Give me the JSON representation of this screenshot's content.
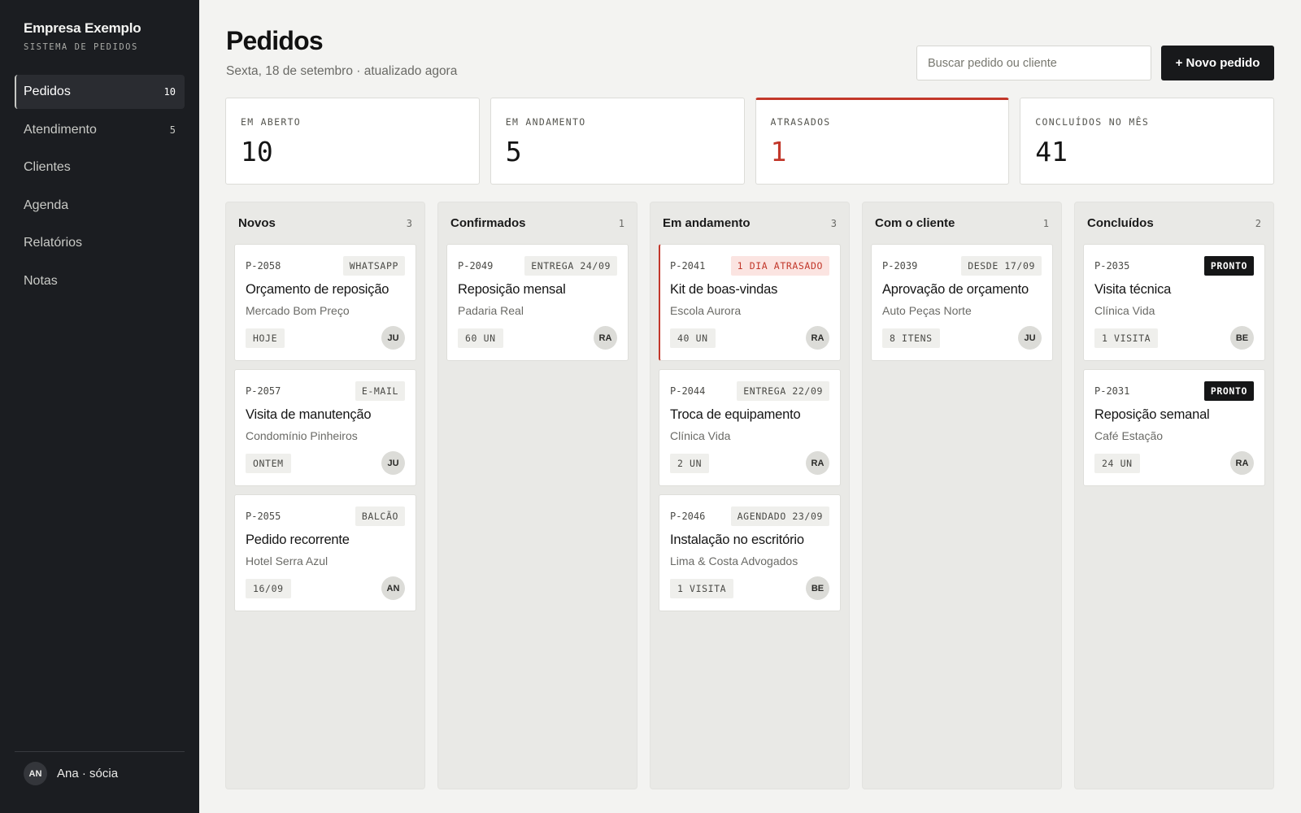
{
  "sidebar": {
    "brand_name": "Empresa Exemplo",
    "brand_sub": "SISTEMA DE PEDIDOS",
    "items": [
      {
        "label": "Pedidos",
        "count": "10",
        "active": true
      },
      {
        "label": "Atendimento",
        "count": "5"
      },
      {
        "label": "Clientes",
        "count": ""
      },
      {
        "label": "Agenda",
        "count": ""
      },
      {
        "label": "Relatórios",
        "count": ""
      },
      {
        "label": "Notas",
        "count": ""
      }
    ],
    "user": {
      "initials": "AN",
      "label": "Ana · sócia"
    }
  },
  "header": {
    "title": "Pedidos",
    "subtitle": "Sexta, 18 de setembro · atualizado agora",
    "search_placeholder": "Buscar pedido ou cliente",
    "new_button": "+ Novo pedido"
  },
  "stats": [
    {
      "label": "EM ABERTO",
      "value": "10"
    },
    {
      "label": "EM ANDAMENTO",
      "value": "5"
    },
    {
      "label": "ATRASADOS",
      "value": "1",
      "alert": true
    },
    {
      "label": "CONCLUÍDOS NO MÊS",
      "value": "41"
    }
  ],
  "board": {
    "columns": [
      {
        "title": "Novos",
        "count": "3",
        "cards": [
          {
            "id": "P-2058",
            "tag": "WHATSAPP",
            "title": "Orçamento de reposição",
            "client": "Mercado Bom Preço",
            "qty": "HOJE",
            "avatar": "JU"
          },
          {
            "id": "P-2057",
            "tag": "E-MAIL",
            "title": "Visita de manutenção",
            "client": "Condomínio Pinheiros",
            "qty": "ONTEM",
            "avatar": "JU"
          },
          {
            "id": "P-2055",
            "tag": "BALCÃO",
            "title": "Pedido recorrente",
            "client": "Hotel Serra Azul",
            "qty": "16/09",
            "avatar": "AN"
          }
        ]
      },
      {
        "title": "Confirmados",
        "count": "1",
        "cards": [
          {
            "id": "P-2049",
            "tag": "ENTREGA 24/09",
            "title": "Reposição mensal",
            "client": "Padaria Real",
            "qty": "60 UN",
            "avatar": "RA"
          }
        ]
      },
      {
        "title": "Em andamento",
        "count": "3",
        "cards": [
          {
            "id": "P-2041",
            "tag": "1 DIA ATRASADO",
            "tag_style": "danger",
            "late": true,
            "title": "Kit de boas-vindas",
            "client": "Escola Aurora",
            "qty": "40 UN",
            "avatar": "RA"
          },
          {
            "id": "P-2044",
            "tag": "ENTREGA 22/09",
            "title": "Troca de equipamento",
            "client": "Clínica Vida",
            "qty": "2 UN",
            "avatar": "RA"
          },
          {
            "id": "P-2046",
            "tag": "AGENDADO 23/09",
            "title": "Instalação no escritório",
            "client": "Lima & Costa Advogados",
            "qty": "1 VISITA",
            "avatar": "BE"
          }
        ]
      },
      {
        "title": "Com o cliente",
        "count": "1",
        "cards": [
          {
            "id": "P-2039",
            "tag": "DESDE 17/09",
            "title": "Aprovação de orçamento",
            "client": "Auto Peças Norte",
            "qty": "8 ITENS",
            "avatar": "JU"
          }
        ]
      },
      {
        "title": "Concluídos",
        "count": "2",
        "cards": [
          {
            "id": "P-2035",
            "tag": "PRONTO",
            "tag_style": "dark",
            "title": "Visita técnica",
            "client": "Clínica Vida",
            "qty": "1 VISITA",
            "avatar": "BE"
          },
          {
            "id": "P-2031",
            "tag": "PRONTO",
            "tag_style": "dark",
            "title": "Reposição semanal",
            "client": "Café Estação",
            "qty": "24 UN",
            "avatar": "RA"
          }
        ]
      }
    ]
  }
}
